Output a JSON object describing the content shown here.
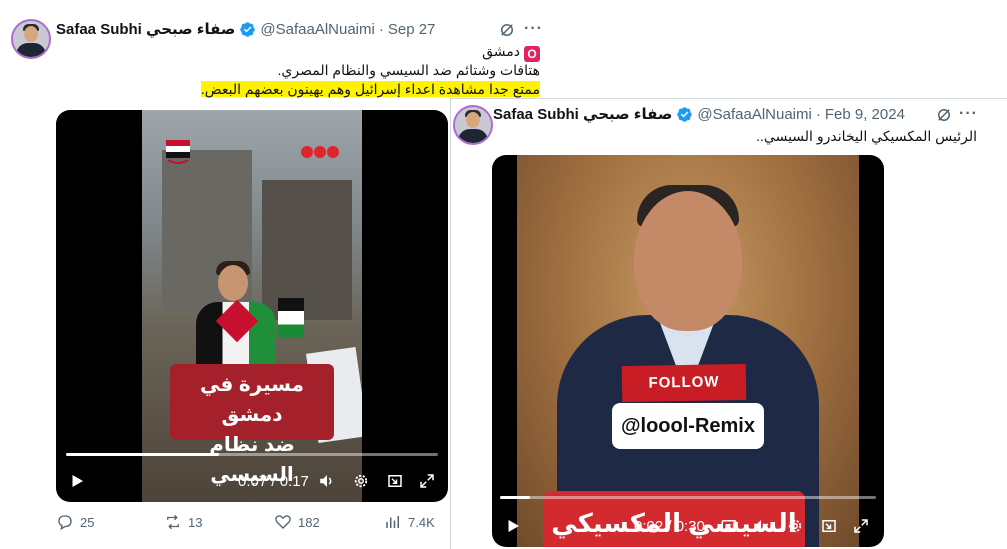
{
  "tweet1": {
    "author_name": "Safaa Subhi صفاء صبحي",
    "handle": "@SafaaAlNuaimi",
    "date": "Sep 27",
    "lines": [
      "دمشق",
      "هتافات وشتائم ضد السيسي والنظام المصري.",
      "ممتع جدا مشاهدة اعداء إسرائيل وهم  يهينون بعضهم البعض."
    ],
    "video": {
      "caption_line1": "مسيرة في دمشق",
      "caption_line2": "ضد نظام السيسي",
      "logo": "300",
      "time": "0:07 / 0:17",
      "progress": 0.41
    },
    "stats": {
      "replies": "25",
      "reposts": "13",
      "likes": "182",
      "views": "7.4K"
    }
  },
  "tweet2": {
    "author_name": "Safaa Subhi صفاء صبحي",
    "handle": "@SafaaAlNuaimi",
    "date": "Feb 9, 2024",
    "text": "الرئيس المكسيكي اليخاندرو السيسي..",
    "video": {
      "follow_label": "FOLLOW",
      "overlay_handle": "@loool-Remix",
      "caption": "السيسي المكسيكي",
      "time": "0:02 / 0:30",
      "progress": 0.08
    }
  },
  "colors": {
    "accent": "#1d9bf0",
    "highlight": "#fff200",
    "caption_red": "#a4212b"
  }
}
